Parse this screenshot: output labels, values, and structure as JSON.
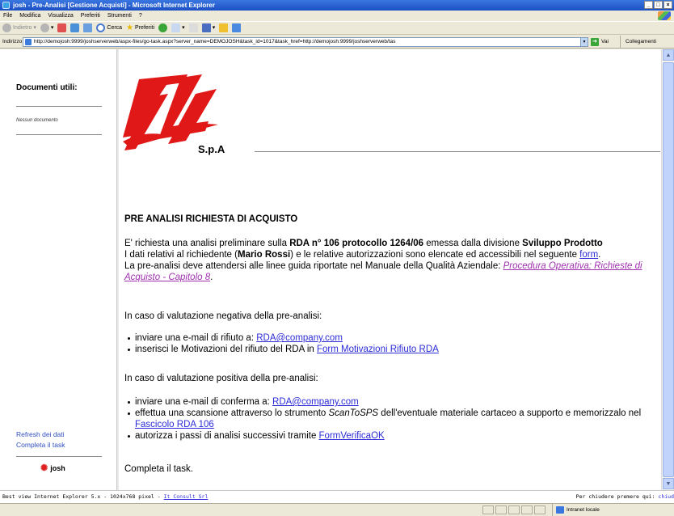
{
  "window": {
    "title": "josh - Pre-Analisi [Gestione Acquisti] - Microsoft Internet Explorer",
    "min_glyph": "_",
    "max_glyph": "□",
    "close_glyph": "×"
  },
  "menu": [
    "File",
    "Modifica",
    "Visualizza",
    "Preferiti",
    "Strumenti",
    "?"
  ],
  "toolbar": {
    "back": "Indietro",
    "search": "Cerca",
    "favorites": "Preferiti"
  },
  "address": {
    "label": "Indirizzo",
    "url": "http://demojosh:9999/joshserverweb/aspx-files/go-task.aspx?server_name=DEMOJOSH&task_id=1017&task_href=http://demojosh:9999/joshserverweb/tas",
    "go": "Vai",
    "links": "Collegamenti"
  },
  "sidebar": {
    "title": "Documenti utili:",
    "no_documents": "Nessun documento",
    "refresh": "Refresh dei dati",
    "complete": "Completa il task",
    "logo_text": "josh"
  },
  "main": {
    "company": "S.p.A",
    "heading": "PRE ANALISI RICHIESTA DI ACQUISTO",
    "p1_a": "E' richiesta una analisi preliminare sulla ",
    "p1_b": "RDA n° 106 protocollo 1264/06",
    "p1_c": " emessa dalla divisione ",
    "p1_d": "Sviluppo Prodotto",
    "p2_a": "I dati relativi al richiedente (",
    "p2_b": "Mario Rossi",
    "p2_c": ") e le relative autorizzazioni sono elencate ed accessibili nel seguente ",
    "p2_link": "form",
    "p2_d": ".",
    "p3_a": "La pre-analisi deve attendersi alle linee guida riportate nel Manuale della Qualità Aziendale: ",
    "p3_link": "Procedura Operativa: Richieste di Acquisto - Capitolo 8",
    "p3_b": ".",
    "neg_intro": "In caso di valutazione negativa della pre-analisi:",
    "neg1_a": "inviare una e-mail di rifiuto a: ",
    "neg1_link": "RDA@company.com",
    "neg2_a": "inserisci le Motivazioni del rifiuto del RDA in ",
    "neg2_link": "Form Motivazioni Rifiuto RDA",
    "pos_intro": "In caso di valutazione positiva della pre-analisi:",
    "pos1_a": "inviare una e-mail di conferma a: ",
    "pos1_link": "RDA@company.com",
    "pos2_a": "effettua una scansione attraverso lo strumento ",
    "pos2_tool": "ScanToSPS",
    "pos2_b": " dell'eventuale materiale cartaceo a supporto e memorizzalo nel ",
    "pos2_link": "Fascicolo RDA 106",
    "pos3_a": "autorizza i passi di analisi successivi tramite ",
    "pos3_link": "FormVerificaOK",
    "complete": "Completa il task."
  },
  "footer": {
    "left": "Best view Internet Explorer 5.x - 1024x768 pixel - ",
    "left_link": "It Consult Srl",
    "right": "Per chiudere premere qui: ",
    "right_link": "chiud"
  },
  "status": {
    "zone": "Intranet locale"
  },
  "colors": {
    "link": "#2b2bd8",
    "visited_link": "#a030b0",
    "logo_red": "#e01818"
  }
}
